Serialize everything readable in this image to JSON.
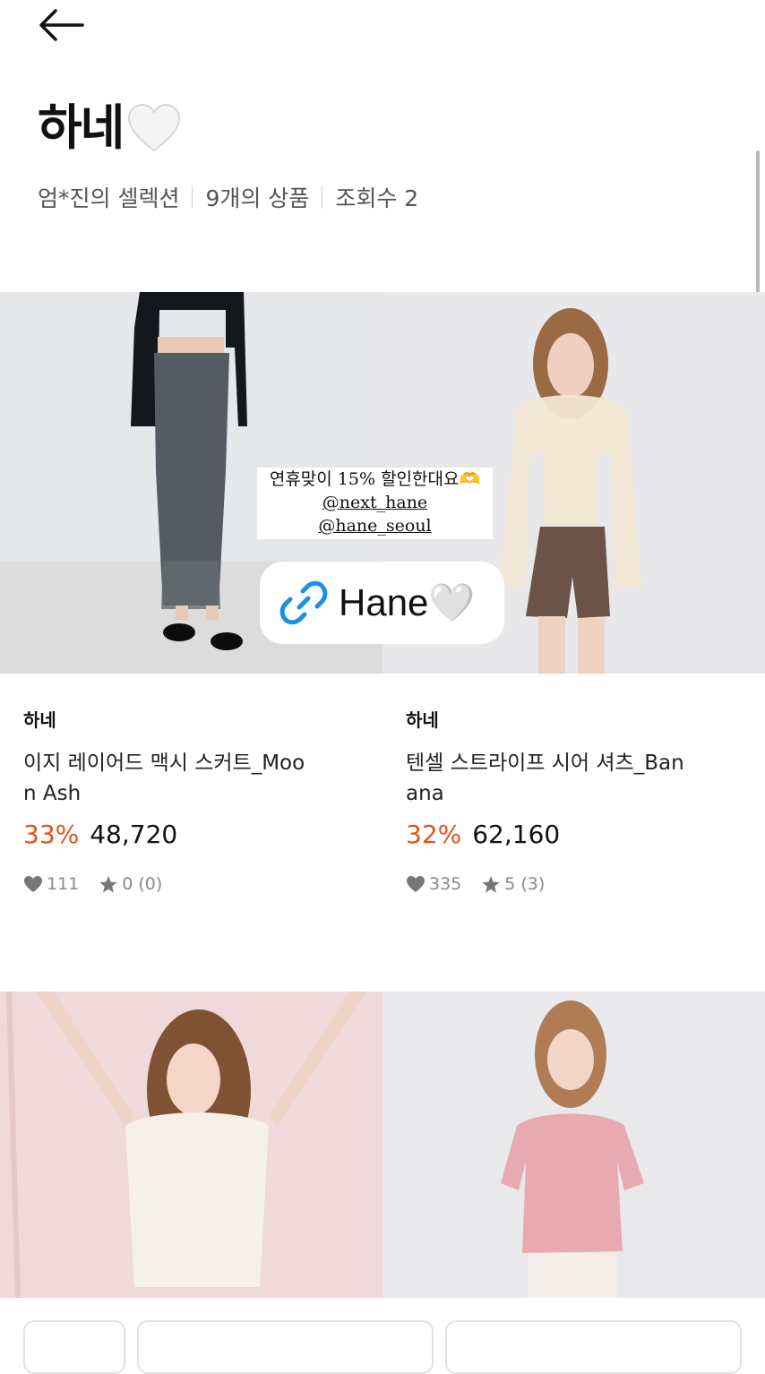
{
  "header": {
    "back_icon": "arrow-left-icon",
    "title": "하네",
    "title_emoji": "white-heart-icon",
    "curator": "엄*진의 셀렉션",
    "product_count": "9개의 상품",
    "views": "조회수 2"
  },
  "banner": {
    "line1": "연휴맞이 15% 할인한대요🫶",
    "line2": "@next_hane",
    "line3": "@hane_seoul",
    "link_label": "Hane🤍",
    "link_icon": "link-icon"
  },
  "products": [
    {
      "brand": "하네",
      "name": "이지 레이어드 맥시 스커트_Moon Ash",
      "discount": "33%",
      "price": "48,720",
      "likes": "111",
      "rating": "0 (0)"
    },
    {
      "brand": "하네",
      "name": "텐셀 스트라이프 시어 셔츠_Banana",
      "discount": "32%",
      "price": "62,160",
      "likes": "335",
      "rating": "5 (3)"
    }
  ],
  "colors": {
    "discount": "#e2521c",
    "meta_text": "#555555",
    "stats_text": "#888888"
  }
}
